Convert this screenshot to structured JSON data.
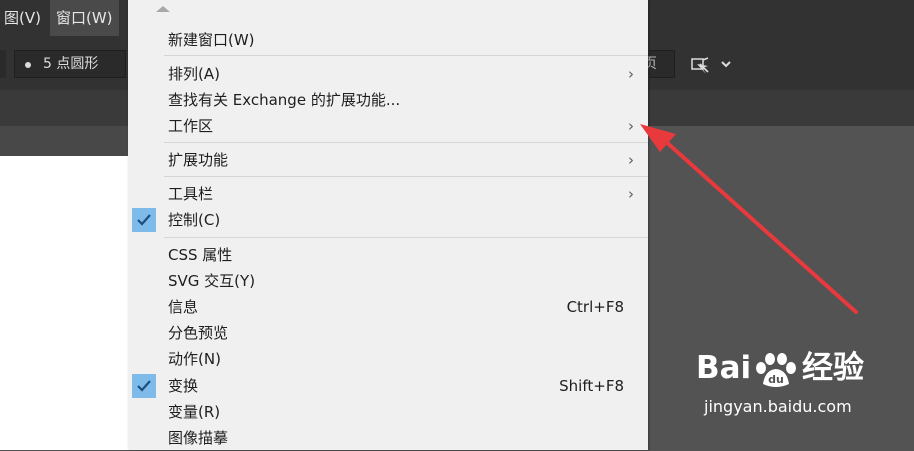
{
  "menubar": {
    "items": [
      {
        "label": "图(V)"
      },
      {
        "label": "窗口(W)"
      }
    ]
  },
  "control_bar": {
    "stroke_value": "5 点圆形",
    "field_fragment": "页"
  },
  "window_menu": {
    "items": [
      {
        "label": "新建窗口(W)"
      },
      {
        "label": "排列(A)",
        "submenu": true
      },
      {
        "label": "查找有关 Exchange 的扩展功能..."
      },
      {
        "label": "工作区",
        "submenu": true
      },
      {
        "label": "扩展功能",
        "submenu": true
      },
      {
        "label": "工具栏",
        "submenu": true
      },
      {
        "label": "控制(C)",
        "checked": true
      },
      {
        "label": "CSS 属性"
      },
      {
        "label": "SVG 交互(Y)"
      },
      {
        "label": "信息",
        "shortcut": "Ctrl+F8"
      },
      {
        "label": "分色预览"
      },
      {
        "label": "动作(N)"
      },
      {
        "label": "变换",
        "checked": true,
        "shortcut": "Shift+F8"
      },
      {
        "label": "变量(R)"
      },
      {
        "label": "图像描摹"
      }
    ],
    "submenu_arrow": "›"
  },
  "watermark": {
    "brand": "Bai",
    "suffix": "经验",
    "url": "jingyan.baidu.com"
  },
  "colors": {
    "annotation_arrow": "#e8393d",
    "check_highlight": "#7fbbe8",
    "menu_bg": "#f0f0f0",
    "app_bg": "#535353"
  },
  "icons": {
    "scroll_up": "triangle-up-icon",
    "check": "checkmark-icon",
    "submenu": "chevron-right-icon",
    "align": "align-to-icon",
    "dropdown": "chevron-down-icon",
    "paw": "paw-icon"
  }
}
